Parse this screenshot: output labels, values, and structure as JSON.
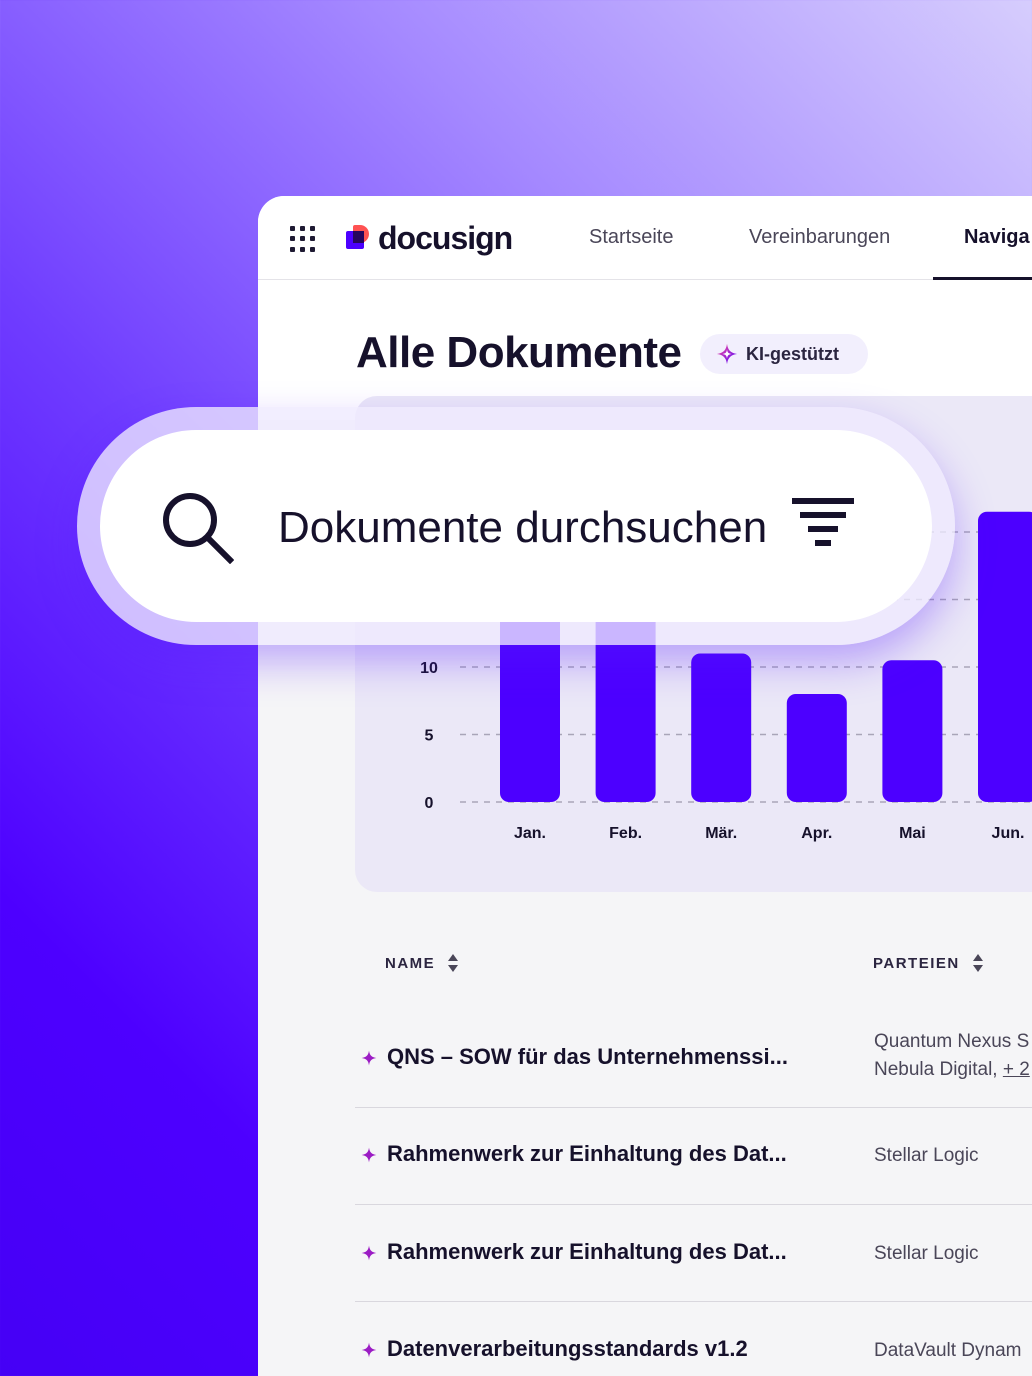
{
  "topbar": {
    "brand": "docusign",
    "nav": [
      {
        "label": "Startseite"
      },
      {
        "label": "Vereinbarungen"
      },
      {
        "label": "Naviga"
      }
    ]
  },
  "page": {
    "title": "Alle Dokumente",
    "ai_badge": "KI-gestützt"
  },
  "search": {
    "placeholder": "Dokumente durchsuchen"
  },
  "chart_data": {
    "type": "bar",
    "categories": [
      "Jan.",
      "Feb.",
      "Mär.",
      "Apr.",
      "Mai",
      "Jun."
    ],
    "values": [
      17,
      17,
      11,
      8,
      10.5,
      21.5
    ],
    "yticks": [
      0,
      5,
      10
    ],
    "ylim": [
      0,
      22
    ],
    "grid": true,
    "bar_color": "#4c00ff"
  },
  "table": {
    "columns": [
      {
        "label": "NAME"
      },
      {
        "label": "PARTEIEN"
      }
    ],
    "rows": [
      {
        "name": "QNS – SOW für das Unternehmenssi...",
        "parties": [
          "Quantum Nexus S",
          "Nebula Digital,"
        ],
        "more": "+ 2"
      },
      {
        "name": "Rahmenwerk zur Einhaltung des Dat...",
        "parties": [
          "Stellar Logic"
        ]
      },
      {
        "name": "Rahmenwerk zur Einhaltung des Dat...",
        "parties": [
          "Stellar Logic"
        ]
      },
      {
        "name": "Datenverarbeitungsstandards v1.2",
        "parties": [
          "DataVault Dynam"
        ]
      }
    ]
  },
  "colors": {
    "accent": "#4c00ff",
    "spark": "#9b1cc4",
    "ink": "#16112b"
  }
}
